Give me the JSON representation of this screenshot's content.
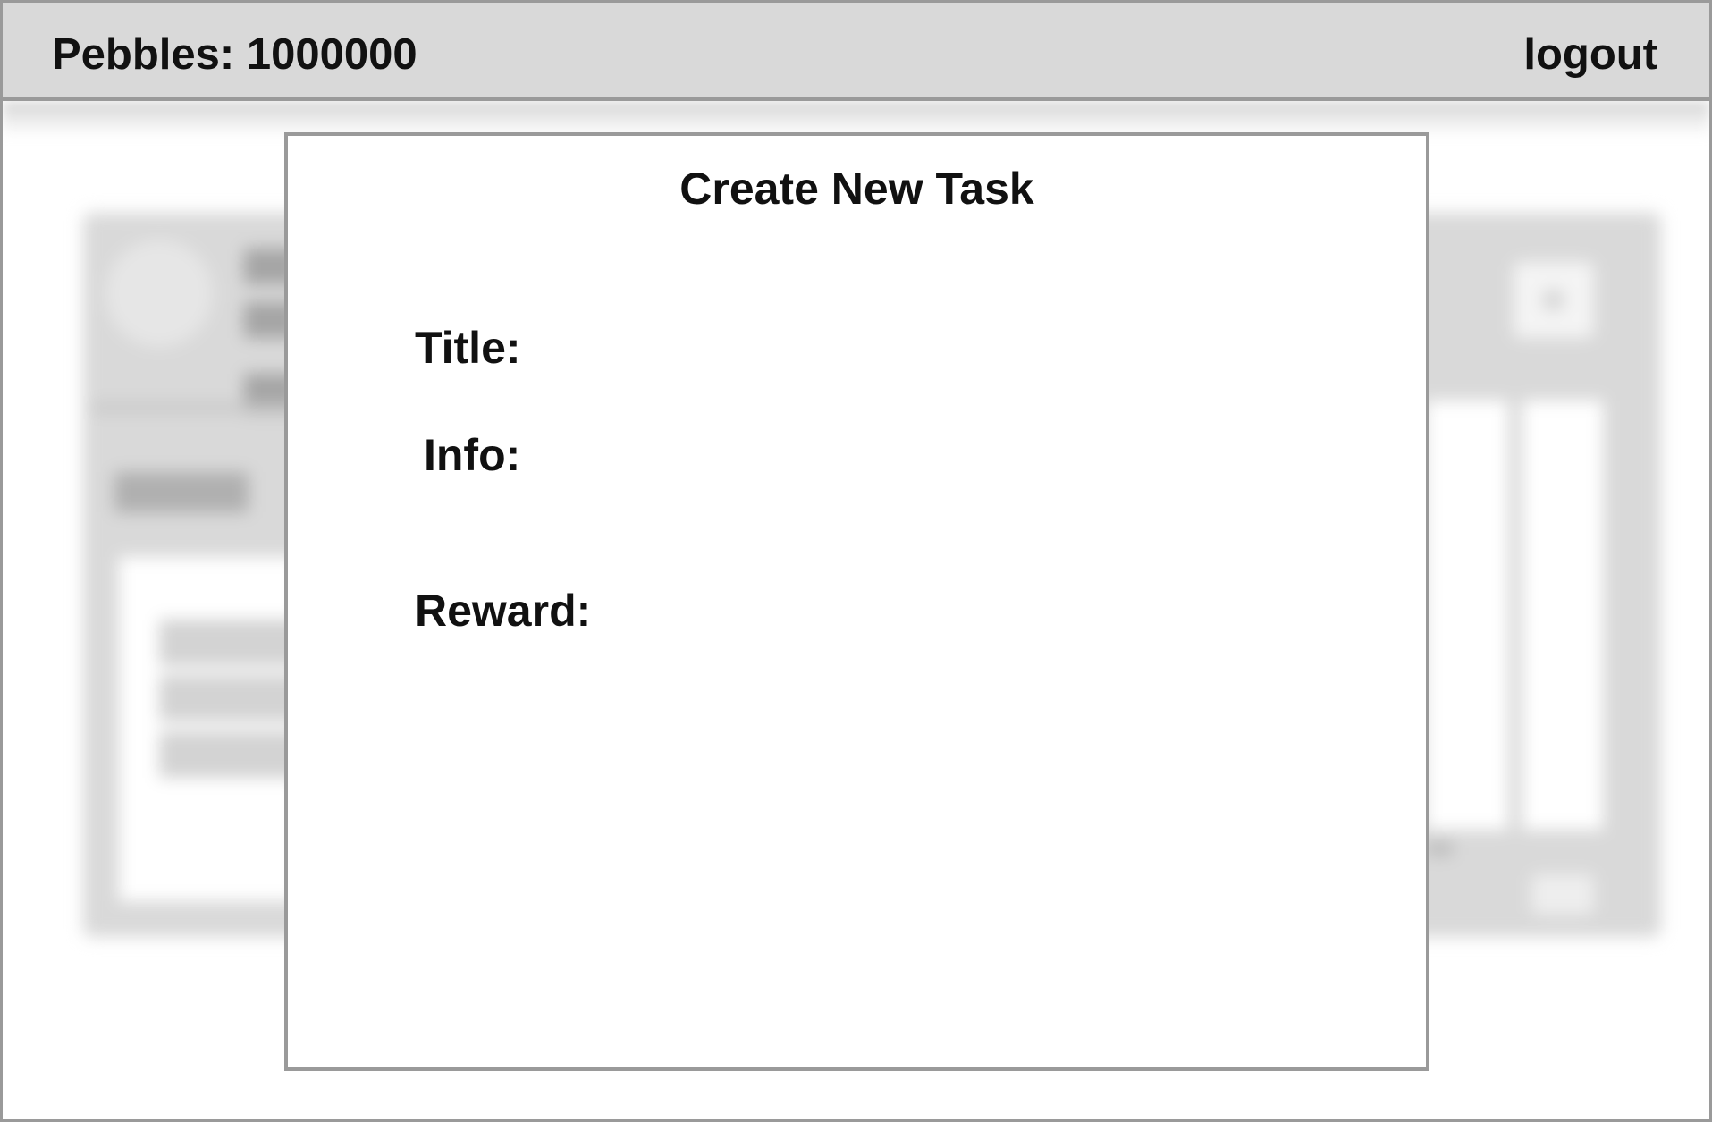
{
  "header": {
    "pebbles_label": "Pebbles: 1000000",
    "logout_label": "logout"
  },
  "modal": {
    "title": "Create New Task",
    "fields": {
      "title_label": "Title:",
      "info_label": "Info:",
      "reward_label": "Reward:"
    }
  },
  "colors": {
    "topbar": "#d9d9d9",
    "border": "#9a9a9a",
    "modal_background": "#ffffff",
    "text": "#111111"
  }
}
